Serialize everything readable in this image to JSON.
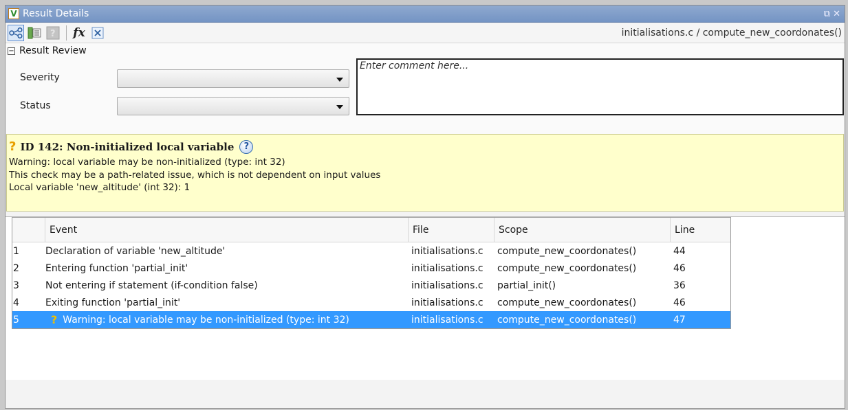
{
  "window": {
    "title": "Result Details",
    "controls": {
      "restore": "⧉",
      "close": "✕"
    }
  },
  "toolbar": {
    "fx_label": "fx",
    "breadcrumb": "initialisations.c / compute_new_coordonates()"
  },
  "review": {
    "header": "Result Review",
    "severity_label": "Severity",
    "status_label": "Status",
    "severity_value": "",
    "status_value": "",
    "comment_placeholder": "Enter comment here..."
  },
  "result": {
    "marker": "?",
    "title": "ID 142: Non-initialized local variable",
    "help": "?",
    "lines": [
      "Warning: local variable may be non-initialized (type: int 32)",
      "This check may be a path-related issue, which is not dependent on input values",
      "Local variable 'new_altitude' (int 32): 1"
    ]
  },
  "events": {
    "columns": {
      "event": "Event",
      "file": "File",
      "scope": "Scope",
      "line": "Line"
    },
    "rows": [
      {
        "num": "1",
        "event": "Declaration of variable 'new_altitude'",
        "file": "initialisations.c",
        "scope": "compute_new_coordonates()",
        "line": "44"
      },
      {
        "num": "2",
        "event": "Entering function 'partial_init'",
        "file": "initialisations.c",
        "scope": "compute_new_coordonates()",
        "line": "46"
      },
      {
        "num": "3",
        "event": "Not entering if statement (if-condition false)",
        "file": "initialisations.c",
        "scope": "partial_init()",
        "line": "36"
      },
      {
        "num": "4",
        "event": "Exiting function 'partial_init'",
        "file": "initialisations.c",
        "scope": "compute_new_coordonates()",
        "line": "46"
      },
      {
        "num": "5",
        "marker": "?",
        "event": "Warning: local variable may be non-initialized (type: int 32)",
        "file": "initialisations.c",
        "scope": "compute_new_coordonates()",
        "line": "47"
      }
    ]
  },
  "colors": {
    "title_bar": "#7f9dca",
    "result_background": "#ffffcc",
    "selection": "#3399ff"
  }
}
